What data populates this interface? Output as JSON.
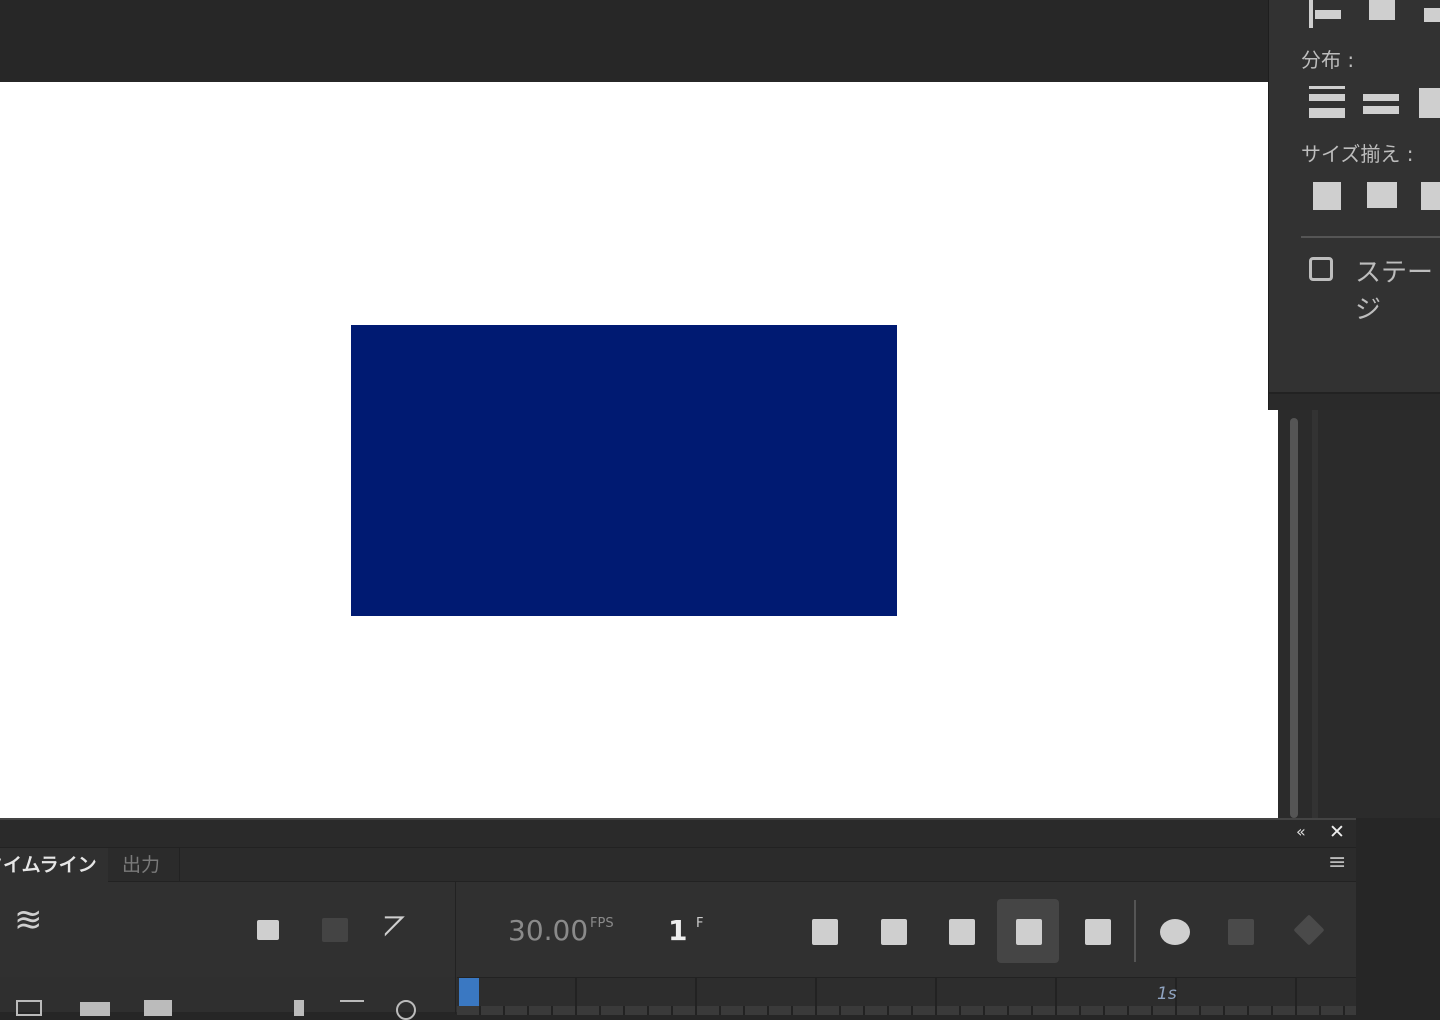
{
  "align_panel": {
    "distribute_label": "分布 :",
    "match_size_label": "サイズ揃え :",
    "stage_checkbox_label": "ステージ",
    "stage_checked": false
  },
  "stage": {
    "shape_color": "#001a72"
  },
  "timeline": {
    "tabs": [
      {
        "label": "タイムライン",
        "active": true
      },
      {
        "label": "出力",
        "active": false
      }
    ],
    "fps_value": "30.00",
    "fps_unit": "FPS",
    "frame_value": "1",
    "frame_unit": "F",
    "ruler_label": "1s",
    "collapse_icon": "«",
    "close_icon": "✕",
    "menu_icon": "≡"
  }
}
